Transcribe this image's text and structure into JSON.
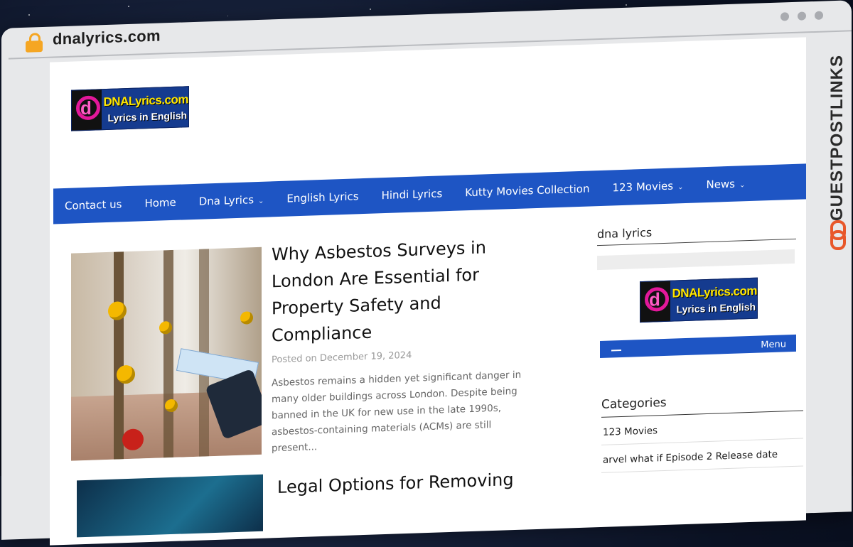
{
  "browser": {
    "url": "dnalyrics.com"
  },
  "site": {
    "logo": {
      "line1": "DNALyrics.com",
      "line2": "Lyrics in English"
    }
  },
  "nav": {
    "items": [
      {
        "label": "Contact us"
      },
      {
        "label": "Home"
      },
      {
        "label": "Dna Lyrics",
        "chevron": "⌄"
      },
      {
        "label": "English Lyrics"
      },
      {
        "label": "Hindi Lyrics"
      },
      {
        "label": "Kutty Movies Collection"
      },
      {
        "label": "123 Movies",
        "chevron": "⌄"
      },
      {
        "label": "News",
        "chevron": "⌄"
      }
    ]
  },
  "posts": [
    {
      "title": "Why Asbestos Surveys in London Are Essential for Property Safety and Compliance",
      "meta": "Posted on December 19, 2024",
      "excerpt": "Asbestos remains a hidden yet significant danger in many older buildings across London. Despite being banned in the UK for new use in the late 1990s, asbestos-containing materials (ACMs) are still present..."
    },
    {
      "title": "Legal Options for Removing"
    }
  ],
  "sidebar": {
    "heading": "dna lyrics",
    "menu_label": "Menu",
    "categories_heading": "Categories",
    "categories": [
      "123 Movies",
      "arvel what if Episode 2 Release date"
    ]
  },
  "watermark": {
    "text": "GUESTPOSTLINKS",
    "icon": "link-icon"
  },
  "colors": {
    "nav": "#1e55c4",
    "accent": "#e8572a",
    "lock": "#f5a623"
  }
}
